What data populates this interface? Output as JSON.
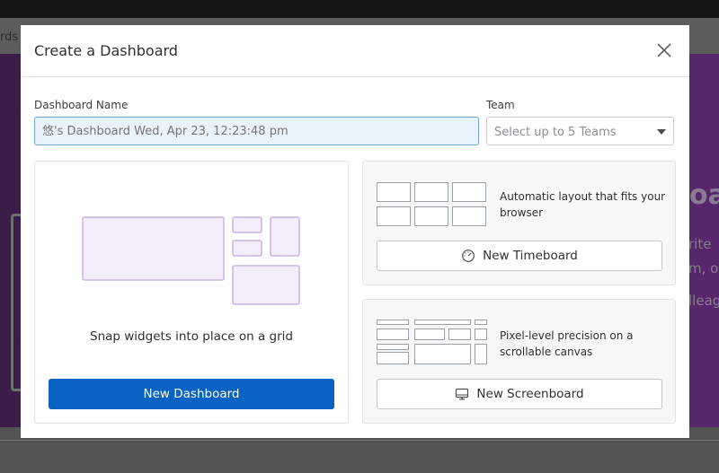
{
  "background": {
    "nav_text": "rds",
    "hero_title": "oa",
    "hero_lines": [
      "rite",
      "m, o",
      "lleag"
    ]
  },
  "modal": {
    "title": "Create a Dashboard",
    "close_icon": "close-icon",
    "name_label": "Dashboard Name",
    "name_placeholder": "悠's Dashboard Wed, Apr 23, 12:23:48 pm",
    "team_label": "Team",
    "team_placeholder": "Select up to 5 Teams",
    "dashboard_card": {
      "description": "Snap widgets into place on a grid",
      "button_label": "New Dashboard"
    },
    "timeboard_card": {
      "description": "Automatic layout that fits your browser",
      "button_label": "New Timeboard",
      "button_icon": "timeboard-icon"
    },
    "screenboard_card": {
      "description": "Pixel-level precision on a scrollable canvas",
      "button_label": "New Screenboard",
      "button_icon": "monitor-icon"
    }
  },
  "colors": {
    "primary": "#0a63c2",
    "input_focus_bg": "#e8f2fb",
    "widget_fill": "#f3ecfb",
    "widget_stroke": "#c9b3e6"
  }
}
